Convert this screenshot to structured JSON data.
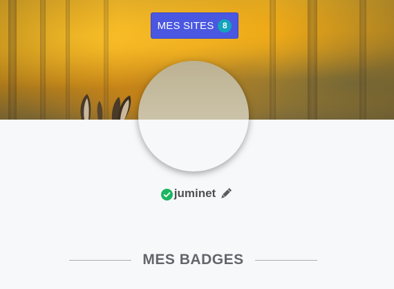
{
  "header": {
    "sites_button": {
      "label": "MES SITES",
      "count": "8"
    },
    "cover_image": "autumn-forest-with-deer-ears"
  },
  "profile": {
    "username": "juminet",
    "verified_icon": "check-circle-icon",
    "edit_icon": "pencil-icon"
  },
  "section": {
    "title": "MES BADGES"
  },
  "colors": {
    "button_bg": "#4a57e1",
    "badge_bg": "#14a3bb",
    "verified_green": "#1bb560",
    "text": "#4d4f53"
  }
}
